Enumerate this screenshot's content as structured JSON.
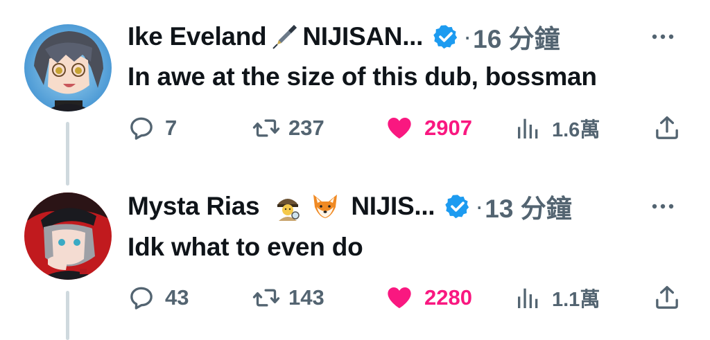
{
  "tweets": [
    {
      "author": "Ike Eveland",
      "author_suffix": "NIJISAN...",
      "emojis": [
        "fountain-pen-emoji"
      ],
      "verified": true,
      "separator": "·",
      "time": "16 分鐘",
      "text": "In awe at the size of this dub, bossman",
      "replies": "7",
      "retweets": "237",
      "likes": "2907",
      "views": "1.6萬",
      "liked": true
    },
    {
      "author": "Mysta Rias",
      "author_suffix": "NIJIS...",
      "emojis": [
        "detective-emoji",
        "fox-emoji"
      ],
      "verified": true,
      "separator": "·",
      "time": "13 分鐘",
      "text": "Idk what to even do",
      "replies": "43",
      "retweets": "143",
      "likes": "2280",
      "views": "1.1萬",
      "liked": true
    }
  ],
  "colors": {
    "text": "#0f1419",
    "secondary": "#536471",
    "like": "#f91880",
    "verified": "#1d9bf0",
    "thread_line": "#cfd9de"
  }
}
